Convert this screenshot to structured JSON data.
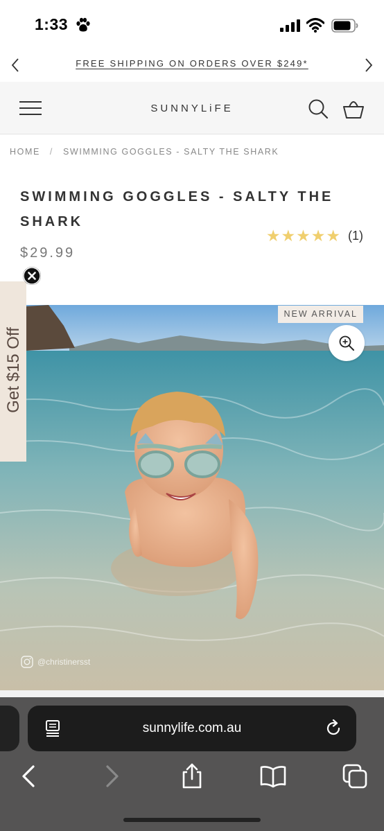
{
  "status_bar": {
    "time": "1:33"
  },
  "announcement": {
    "text": "FREE SHIPPING ON ORDERS OVER $249*"
  },
  "header": {
    "logo": "SUNNYLiFE"
  },
  "breadcrumb": {
    "home": "HOME",
    "separator": "/",
    "current": "SWIMMING GOGGLES - SALTY THE SHARK"
  },
  "product": {
    "title": "SWIMMING GOGGLES - SALTY THE SHARK",
    "rating": 5,
    "rating_max": 5,
    "review_count": "(1)",
    "price": "$29.99",
    "badge": "NEW ARRIVAL",
    "image_credit": "@christinersst"
  },
  "side_promo": {
    "text": "Get $15 Off"
  },
  "browser": {
    "url": "sunnylife.com.au"
  },
  "colors": {
    "star": "#f0cf6e",
    "header_bg": "#f6f6f6",
    "promo_bg": "#efe6dc"
  }
}
